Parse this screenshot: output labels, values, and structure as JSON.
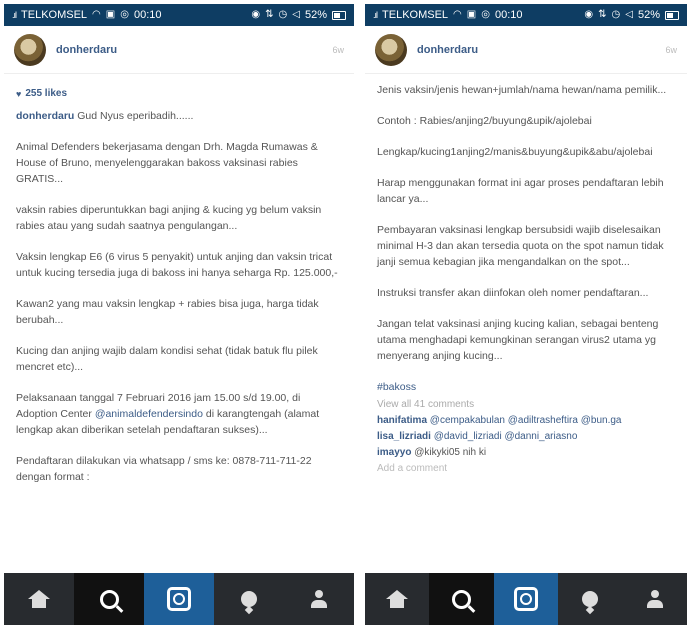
{
  "left": {
    "status": {
      "carrier": "TELKOMSEL",
      "time": "00:10",
      "battery": "52%"
    },
    "post": {
      "username": "donherdaru",
      "time_ago": "6w",
      "likes": "255 likes",
      "author": "donherdaru",
      "paragraphs": [
        "Gud Nyus eperibadih......",
        "Animal Defenders bekerjasama dengan Drh. Magda Rumawas & House of Bruno, menyelenggarakan bakoss vaksinasi rabies GRATIS...",
        "vaksin rabies diperuntukkan bagi anjing & kucing yg belum vaksin rabies atau yang sudah saatnya pengulangan...",
        "Vaksin lengkap E6 (6 virus 5 penyakit) untuk anjing dan vaksin tricat untuk kucing tersedia juga di bakoss ini hanya seharga Rp. 125.000,-",
        "Kawan2 yang mau vaksin lengkap + rabies bisa juga, harga tidak berubah...",
        "Kucing dan anjing wajib dalam kondisi sehat (tidak batuk flu pilek mencret etc)..."
      ],
      "event_before": "Pelaksanaan tanggal 7 Februari 2016 jam 15.00 s/d 19.00, di Adoption Center ",
      "event_mention": "@animaldefendersindo",
      "event_after": " di karangtengah (alamat lengkap akan diberikan setelah pendaftaran sukses)...",
      "registration": "Pendaftaran dilakukan via whatsapp / sms ke: 0878-711-711-22 dengan format :"
    }
  },
  "right": {
    "status": {
      "carrier": "TELKOMSEL",
      "time": "00:10",
      "battery": "52%"
    },
    "post": {
      "username": "donherdaru",
      "time_ago": "6w",
      "paragraphs": [
        "Jenis vaksin/jenis hewan+jumlah/nama hewan/nama pemilik...",
        "Contoh : Rabies/anjing2/buyung&upik/ajolebai",
        "Lengkap/kucing1anjing2/manis&buyung&upik&abu/ajolebai",
        "Harap menggunakan format ini agar proses pendaftaran lebih lancar ya...",
        "Pembayaran vaksinasi lengkap bersubsidi wajib diselesaikan minimal H-3 dan akan tersedia quota on the spot namun tidak janji semua kebagian jika mengandalkan on the spot...",
        "Instruksi transfer akan diinfokan oleh nomer pendaftaran...",
        "Jangan telat vaksinasi anjing kucing kalian, sebagai benteng utama menghadapi kemungkinan serangan virus2 utama yg menyerang anjing kucing..."
      ],
      "hashtag": "#bakoss",
      "view_all": "View all 41 comments",
      "comments": [
        {
          "user": "hanifatima",
          "text": " @cempakabulan @adiltrasheftira @bun.ga"
        },
        {
          "user": "lisa_lizriadi",
          "text": " @david_lizriadi @danni_ariasno"
        },
        {
          "user": "imayyo",
          "text": " @kikyki05 nih ki"
        }
      ],
      "add_comment": "Add a comment"
    }
  },
  "nav": {
    "items": [
      "home-icon",
      "search-icon",
      "camera-icon",
      "activity-icon",
      "profile-icon"
    ]
  }
}
